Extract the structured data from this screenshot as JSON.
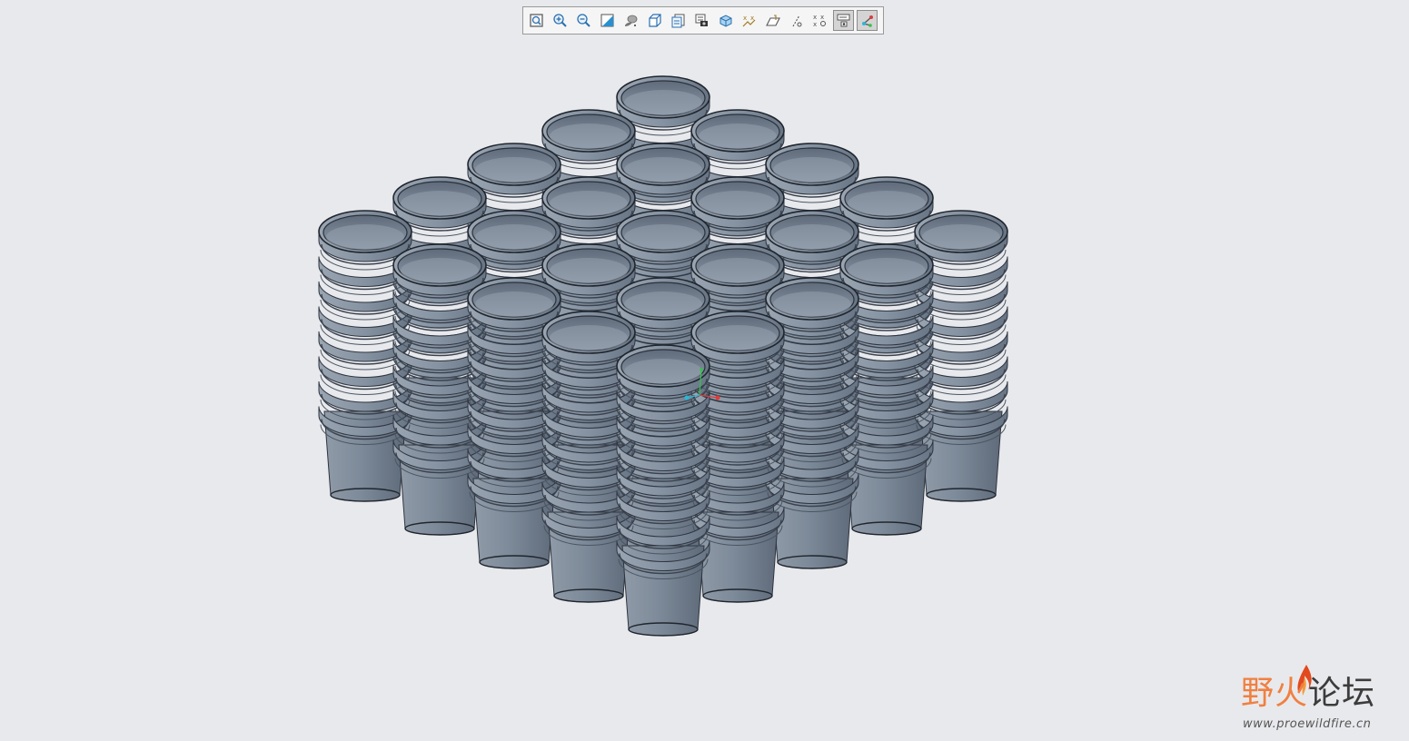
{
  "toolbar": {
    "buttons": [
      {
        "icon": "refit-icon",
        "active": false
      },
      {
        "icon": "zoom-in-icon",
        "active": false
      },
      {
        "icon": "zoom-out-icon",
        "active": false
      },
      {
        "icon": "repaint-icon",
        "active": false
      },
      {
        "icon": "display-style-icon",
        "active": false
      },
      {
        "icon": "saved-orientations-icon",
        "active": false
      },
      {
        "icon": "view-manager-icon",
        "active": false
      },
      {
        "icon": "perspective-view-icon",
        "active": false
      },
      {
        "icon": "spin-center-icon",
        "active": false
      },
      {
        "icon": "datum-display-icon",
        "active": false
      },
      {
        "icon": "plane-display-icon",
        "active": false
      },
      {
        "icon": "axis-display-icon",
        "active": false
      },
      {
        "icon": "point-display-icon",
        "active": false
      },
      {
        "icon": "annotation-display-icon",
        "active": true
      },
      {
        "icon": "csys-display-icon",
        "active": true
      }
    ]
  },
  "model": {
    "object": "stacked cups",
    "grid_rows": 5,
    "grid_cols": 5,
    "cup_color": "#7d8a99",
    "rim_color": "#8e9aa8",
    "inner_color": "#6e7b8a"
  },
  "colors": {
    "background": "#e8e9ec",
    "axis_x": "#e03a3a",
    "axis_y": "#35c24a",
    "axis_z": "#2bb7d6",
    "watermark_orange": "#f08040"
  },
  "watermark": {
    "title_part1": "野火",
    "title_part2": "论坛",
    "url": "www.proewildfire.cn"
  }
}
